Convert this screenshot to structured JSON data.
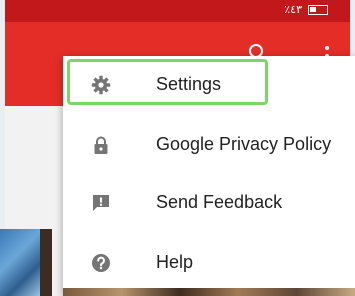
{
  "status_bar": {
    "text": "٪٤٣"
  },
  "colors": {
    "status_bar": "#c2181b",
    "app_bar": "#e52d27",
    "highlight": "#7bd66a"
  },
  "menu": {
    "items": [
      {
        "label": "Settings",
        "icon": "gear-icon",
        "highlighted": true
      },
      {
        "label": "Google Privacy Policy",
        "icon": "lock-icon",
        "highlighted": false
      },
      {
        "label": "Send Feedback",
        "icon": "feedback-icon",
        "highlighted": false
      },
      {
        "label": "Help",
        "icon": "help-icon",
        "highlighted": false
      }
    ]
  }
}
